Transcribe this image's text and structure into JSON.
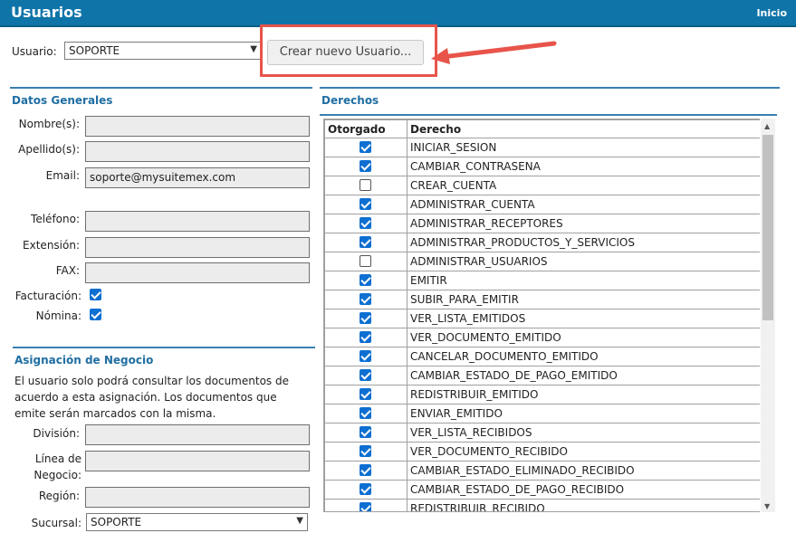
{
  "header": {
    "title": "Usuarios",
    "home": "Inicio"
  },
  "user_select": {
    "label": "Usuario:",
    "value": "SOPORTE"
  },
  "new_user_button": "Crear nuevo Usuario...",
  "datos_generales": {
    "title": "Datos Generales",
    "fields": {
      "nombres_label": "Nombre(s):",
      "nombres_value": "",
      "apellidos_label": "Apellido(s):",
      "apellidos_value": "",
      "email_label": "Email:",
      "email_value": "soporte@mysuitemex.com",
      "telefono_label": "Teléfono:",
      "telefono_value": "",
      "extension_label": "Extensión:",
      "extension_value": "",
      "fax_label": "FAX:",
      "fax_value": ""
    },
    "facturacion_label": "Facturación:",
    "facturacion_checked": true,
    "nomina_label": "Nómina:",
    "nomina_checked": true
  },
  "asignacion": {
    "title": "Asignación de Negocio",
    "description": "El usuario solo podrá consultar los documentos de acuerdo a esta asignación. Los documentos que emite serán marcados con la misma.",
    "division_label": "División:",
    "linea_label_1": "Línea de",
    "linea_label_2": "Negocio:",
    "region_label": "Región:",
    "sucursal_label": "Sucursal:",
    "sucursal_value": "SOPORTE"
  },
  "derechos": {
    "title": "Derechos",
    "col_otorgado": "Otorgado",
    "col_derecho": "Derecho",
    "rows": [
      {
        "name": "INICIAR_SESION",
        "checked": true
      },
      {
        "name": "CAMBIAR_CONTRASENA",
        "checked": true
      },
      {
        "name": "CREAR_CUENTA",
        "checked": false
      },
      {
        "name": "ADMINISTRAR_CUENTA",
        "checked": true
      },
      {
        "name": "ADMINISTRAR_RECEPTORES",
        "checked": true
      },
      {
        "name": "ADMINISTRAR_PRODUCTOS_Y_SERVICIOS",
        "checked": true
      },
      {
        "name": "ADMINISTRAR_USUARIOS",
        "checked": false
      },
      {
        "name": "EMITIR",
        "checked": true
      },
      {
        "name": "SUBIR_PARA_EMITIR",
        "checked": true
      },
      {
        "name": "VER_LISTA_EMITIDOS",
        "checked": true
      },
      {
        "name": "VER_DOCUMENTO_EMITIDO",
        "checked": true
      },
      {
        "name": "CANCELAR_DOCUMENTO_EMITIDO",
        "checked": true
      },
      {
        "name": "CAMBIAR_ESTADO_DE_PAGO_EMITIDO",
        "checked": true
      },
      {
        "name": "REDISTRIBUIR_EMITIDO",
        "checked": true
      },
      {
        "name": "ENVIAR_EMITIDO",
        "checked": true
      },
      {
        "name": "VER_LISTA_RECIBIDOS",
        "checked": true
      },
      {
        "name": "VER_DOCUMENTO_RECIBIDO",
        "checked": true
      },
      {
        "name": "CAMBIAR_ESTADO_ELIMINADO_RECIBIDO",
        "checked": true
      },
      {
        "name": "CAMBIAR_ESTADO_DE_PAGO_RECIBIDO",
        "checked": true
      },
      {
        "name": "REDISTRIBUIR_RECIBIDO",
        "checked": true
      }
    ]
  },
  "colors": {
    "header_bg": "#0f74a8",
    "section_title": "#1f6ea2",
    "checkbox_on": "#0d6fd1",
    "highlight": "#e8544a"
  },
  "icons": {
    "select_chevron": "chevron-down-icon",
    "annotation_arrow": "arrow-left-icon"
  }
}
